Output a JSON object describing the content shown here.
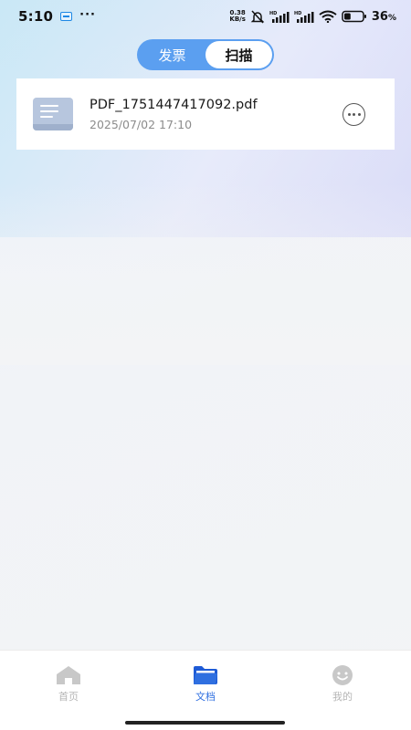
{
  "status_bar": {
    "time": "5:10",
    "speed_value": "0.38",
    "speed_unit": "KB/s",
    "battery_pct": "36",
    "battery_sign": "%",
    "battery_level": 0.36
  },
  "tabs": [
    {
      "label": "发票",
      "active": false
    },
    {
      "label": "扫描",
      "active": true
    }
  ],
  "files": [
    {
      "name": "PDF_1751447417092.pdf",
      "date": "2025/07/02 17:10",
      "icon": "document-icon"
    }
  ],
  "bottom_nav": [
    {
      "label": "首页",
      "icon": "home-icon",
      "active": false
    },
    {
      "label": "文档",
      "icon": "folder-icon",
      "active": true
    },
    {
      "label": "我的",
      "icon": "smile-icon",
      "active": false
    }
  ],
  "colors": {
    "accent": "#2f6fe0",
    "tab_bg": "#5b9ff0",
    "inactive_nav": "#c8c8c8"
  }
}
